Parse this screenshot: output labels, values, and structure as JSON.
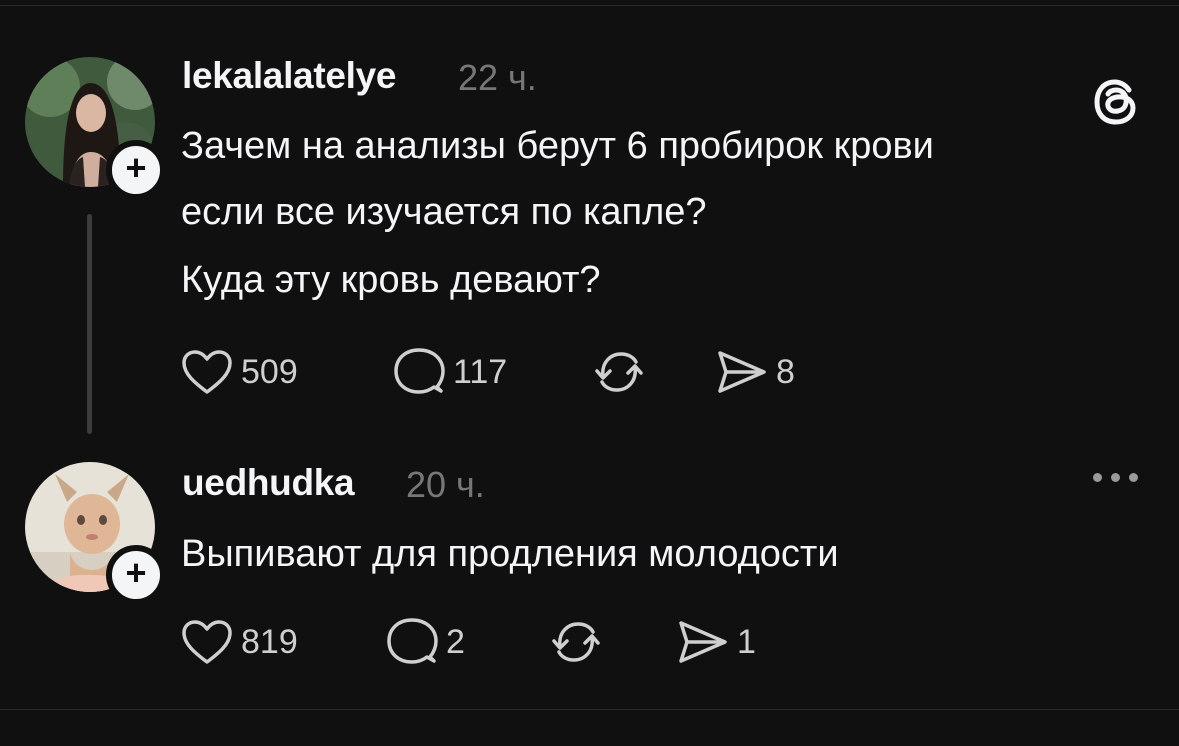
{
  "posts": [
    {
      "username": "lekalalatelye",
      "time": "22 ч.",
      "text_lines": [
        "Зачем на анализы берут 6 пробирок крови",
        "если все изучается по капле?",
        "Куда эту кровь девают?"
      ],
      "likes": "509",
      "replies": "117",
      "shares": "8"
    },
    {
      "username": "uedhudka",
      "time": "20 ч.",
      "text_lines": [
        "Выпивают для продления молодости"
      ],
      "likes": "819",
      "replies": "2",
      "shares": "1"
    }
  ],
  "icons": {
    "brand": "threads-logo-icon",
    "like": "heart-icon",
    "reply": "comment-bubble-icon",
    "repost": "repost-icon",
    "share": "send-icon",
    "more": "more-dots-icon",
    "follow": "plus-icon"
  },
  "colors": {
    "background": "#101010",
    "text": "#f3f5f7",
    "muted": "#777777",
    "thread_line": "#3c3c3c"
  }
}
